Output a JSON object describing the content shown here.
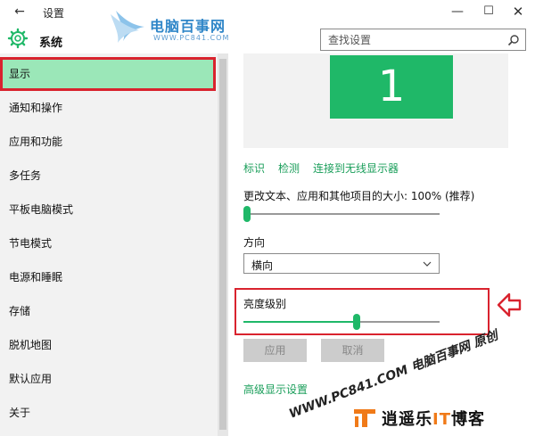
{
  "window": {
    "title": "设置",
    "back_glyph": "←",
    "minimize_glyph": "—",
    "maximize_glyph": "☐",
    "close_glyph": "✕"
  },
  "watermark_top": {
    "name": "电脑百事网",
    "url": "WWW.PC841.COM"
  },
  "header": {
    "section_icon": "gear-icon",
    "section_title": "系统"
  },
  "search": {
    "placeholder": "查找设置",
    "icon": "search-icon"
  },
  "sidebar": {
    "items": [
      {
        "label": "显示",
        "active": true
      },
      {
        "label": "通知和操作"
      },
      {
        "label": "应用和功能"
      },
      {
        "label": "多任务"
      },
      {
        "label": "平板电脑模式"
      },
      {
        "label": "节电模式"
      },
      {
        "label": "电源和睡眠"
      },
      {
        "label": "存储"
      },
      {
        "label": "脱机地图"
      },
      {
        "label": "默认应用"
      },
      {
        "label": "关于"
      }
    ]
  },
  "display": {
    "monitor_number": "1",
    "links": [
      "标识",
      "检测",
      "连接到无线显示器"
    ],
    "scale_label": "更改文本、应用和其他项目的大小: 100% (推荐)",
    "scale_slider_level": 0,
    "orientation_label": "方向",
    "orientation_value": "横向",
    "brightness_label": "亮度级别",
    "brightness_level": 0.58,
    "apply_button": "应用",
    "cancel_button": "取消",
    "advanced_link": "高级显示设置"
  },
  "colors": {
    "accent": "#1fb868",
    "highlight": "#d9232e",
    "selected_bg": "#9be7b8",
    "link": "#1a9e5a"
  },
  "watermark_bottom": {
    "text": "WWW.PC841.COM 电脑百事网 原创",
    "brand_prefix": "逍遥乐",
    "brand_it": "IT",
    "brand_suffix": "博客"
  }
}
